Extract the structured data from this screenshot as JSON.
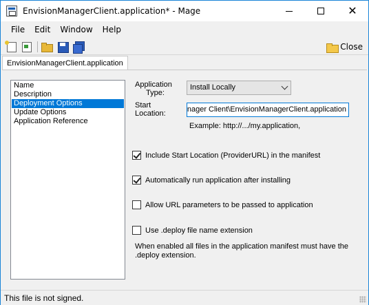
{
  "window": {
    "title": "EnvisionManagerClient.application* - Mage",
    "minimize": "—",
    "maximize": "☐",
    "close": "✕"
  },
  "menu": {
    "items": [
      "File",
      "Edit",
      "Window",
      "Help"
    ]
  },
  "toolbar": {
    "close_label": "Close",
    "icons": [
      "new-application-icon",
      "new-deployment-icon",
      "open-folder-icon",
      "save-icon",
      "save-all-icon",
      "folder-icon"
    ]
  },
  "document_tab": "EnvisionManagerClient.application",
  "nav": {
    "items": [
      "Name",
      "Description",
      "Deployment Options",
      "Update Options",
      "Application Reference"
    ],
    "selected": "Deployment Options"
  },
  "form": {
    "application_type_label_line1": "Application",
    "application_type_label_line2": "Type:",
    "application_type_value": "Install Locally",
    "start_location_label_line1": "Start",
    "start_location_label_line2": "Location:",
    "start_location_value": "anager Client\\EnvisionManagerClient.application",
    "example_text": "Example: http://.../my.application,",
    "checkboxes": [
      {
        "label": "Include Start Location (ProviderURL) in the manifest",
        "checked": true
      },
      {
        "label": "Automatically run application after installing",
        "checked": true
      },
      {
        "label": "Allow URL parameters to be passed to application",
        "checked": false
      },
      {
        "label": "Use .deploy file name extension",
        "checked": false
      }
    ],
    "note_line1": "When enabled all files in the application manifest must have the",
    "note_line2": ".deploy extension."
  },
  "status": {
    "text": "This file is not signed."
  }
}
